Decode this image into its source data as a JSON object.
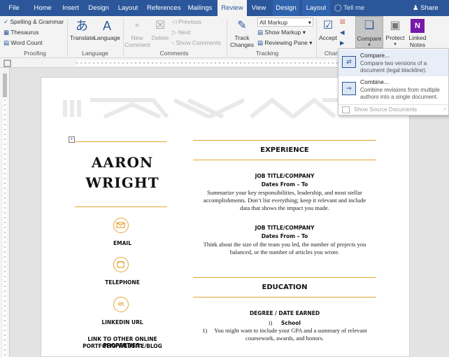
{
  "tabs": [
    "File",
    "Home",
    "Insert",
    "Design",
    "Layout",
    "References",
    "Mailings",
    "Review",
    "View",
    "Design",
    "Layout"
  ],
  "tell_me": "Tell me",
  "share": "Share",
  "ribbon": {
    "proofing": {
      "spelling": "Spelling & Grammar",
      "thesaurus": "Thesaurus",
      "word_count": "Word Count",
      "label": "Proofing"
    },
    "language": {
      "translate": "Translate",
      "language": "Language",
      "label": "Language"
    },
    "comments": {
      "new": "New Comment",
      "delete": "Delete",
      "previous": "Previous",
      "next": "Next",
      "show": "Show Comments",
      "label": "Comments"
    },
    "tracking": {
      "track": "Track Changes",
      "all_markup": "All Markup",
      "show_markup": "Show Markup",
      "reviewing_pane": "Reviewing Pane",
      "label": "Tracking"
    },
    "changes": {
      "accept": "Accept",
      "label": "Chan"
    },
    "compare": {
      "compare": "Compare"
    },
    "protect": {
      "protect": "Protect"
    },
    "onenote": {
      "linked_notes": "Linked Notes"
    }
  },
  "dropdown": {
    "compare_title": "Compare...",
    "compare_desc_1": "Compare two versions of a",
    "compare_desc_2": "document (legal blackline).",
    "combine_title": "Combine...",
    "combine_desc_1": "Combine revisions from multiple",
    "combine_desc_2": "authors into a single document.",
    "show_source": "Show Source Documents"
  },
  "resume": {
    "first_name": "AARON",
    "last_name": "WRIGHT",
    "email": "EMAIL",
    "telephone": "TELEPHONE",
    "linkedin": "LINKEDIN URL",
    "other_1": "LINK TO OTHER ONLINE PROPERTIES:",
    "other_2": "PORTFOLIO/WEBSITE/BLOG",
    "experience": "EXPERIENCE",
    "job1_title": "JOB TITLE/COMPANY",
    "job1_dates": "Dates From – To",
    "job1_l1": "Summarize your key responsibilities, leadership, and most stellar",
    "job1_l2": "accomplishments. Don’t list everything; keep it relevant and include",
    "job1_l3": "data that shows the impact you made.",
    "job2_title": "JOB TITLE/COMPANY",
    "job2_dates": "Dates From – To",
    "job2_l1": "Think about the size of the team you led, the number of projects you",
    "job2_l2": "balanced, or the number of articles you wrote.",
    "education": "EDUCATION",
    "degree": "DEGREE / DATE EARNED",
    "school_num": "i)",
    "school": "School",
    "edu_num": "1)",
    "edu_l1": "You might want to include your GPA and a summary of relevant",
    "edu_l2": "coursework, awards, and honors."
  },
  "colors": {
    "accent": "#2b579a",
    "gold": "#e6a535"
  }
}
